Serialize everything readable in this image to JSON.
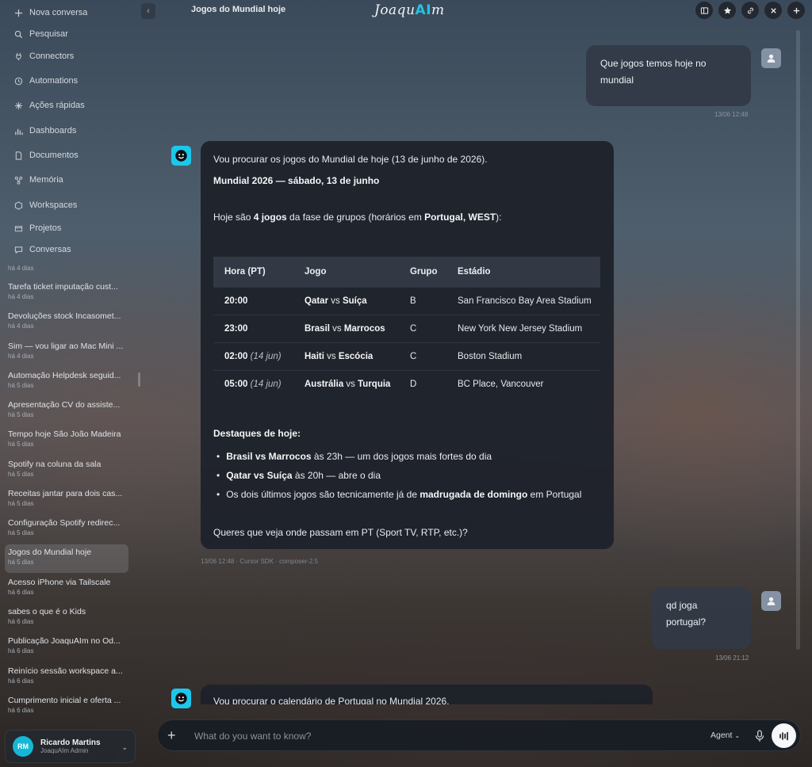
{
  "sidebar": {
    "nav": [
      {
        "label": "Nova conversa",
        "icon": "plus-icon"
      },
      {
        "label": "Pesquisar",
        "icon": "search-icon"
      },
      {
        "label": "Connectors",
        "icon": "plug-icon"
      },
      {
        "label": "Automations",
        "icon": "clock-icon"
      },
      {
        "label": "Ações rápidas",
        "icon": "sparkle-icon"
      },
      {
        "label": "Dashboards",
        "icon": "bar-chart-icon"
      },
      {
        "label": "Documentos",
        "icon": "document-icon"
      },
      {
        "label": "Memória",
        "icon": "memory-icon"
      },
      {
        "label": "Workspaces",
        "icon": "hexagon-icon"
      },
      {
        "label": "Projetos",
        "icon": "folder-icon"
      },
      {
        "label": "Conversas",
        "icon": "chat-bubble-icon"
      }
    ],
    "partial_date": "há 4 dias",
    "conversations": [
      {
        "title": "Tarefa ticket imputação cust...",
        "date": "há 4 dias"
      },
      {
        "title": "Devoluções stock Incasomet...",
        "date": "há 4 dias"
      },
      {
        "title": "Sim — vou ligar ao Mac Mini ...",
        "date": "há 4 dias"
      },
      {
        "title": "Automação Helpdesk seguid...",
        "date": "há 5 dias"
      },
      {
        "title": "Apresentação CV do assiste...",
        "date": "há 5 dias"
      },
      {
        "title": "Tempo hoje São João Madeira",
        "date": "há 5 dias"
      },
      {
        "title": "Spotify na coluna da sala",
        "date": "há 5 dias"
      },
      {
        "title": "Receitas jantar para dois cas...",
        "date": "há 5 dias"
      },
      {
        "title": "Configuração Spotify redirec...",
        "date": "há 5 dias"
      },
      {
        "title": "Jogos do Mundial hoje",
        "date": "há 5 dias"
      },
      {
        "title": "Acesso iPhone via Tailscale",
        "date": "há 6 dias"
      },
      {
        "title": "sabes o que é o Kids",
        "date": "há 6 dias"
      },
      {
        "title": "Publicação JoaquAIm no Od...",
        "date": "há 6 dias"
      },
      {
        "title": "Reinício sessão workspace a...",
        "date": "há 6 dias"
      },
      {
        "title": "Cumprimento inicial e oferta ...",
        "date": "há 6 dias"
      }
    ],
    "active_index": 9,
    "user": {
      "initials": "RM",
      "name": "Ricardo Martins",
      "role": "JoaquAIm Admin",
      "avatar_color": "#14b8d6"
    }
  },
  "header": {
    "title": "Jogos do Mundial hoje",
    "logo_pre": "Joaqu",
    "logo_ai": "AI",
    "logo_post": "m",
    "accent": "#21c4e6"
  },
  "messages": {
    "m1": {
      "line1": "Que jogos temos hoje no",
      "line2": "mundial",
      "time": "13/06 12:48"
    },
    "m2": {
      "intro": "Vou procurar os jogos do Mundial de hoje (13 de junho de 2026).",
      "heading": "Mundial 2026 — sábado, 13 de junho",
      "summary_a": "Hoje são ",
      "summary_b": "4 jogos",
      "summary_c": " da fase de grupos (horários em ",
      "summary_d": "Portugal, WEST",
      "summary_e": "):",
      "table": {
        "headers": [
          "Hora (PT)",
          "Jogo",
          "Grupo",
          "Estádio"
        ],
        "rows": [
          {
            "time": "20:00",
            "note": "",
            "team1": "Qatar",
            "vs": "vs",
            "team2": "Suíça",
            "group": "B",
            "stadium": "San Francisco Bay Area Stadium"
          },
          {
            "time": "23:00",
            "note": "",
            "team1": "Brasil",
            "vs": "vs",
            "team2": "Marrocos",
            "group": "C",
            "stadium": "New York New Jersey Stadium"
          },
          {
            "time": "02:00",
            "note": "(14 jun)",
            "team1": "Haiti",
            "vs": "vs",
            "team2": "Escócia",
            "group": "C",
            "stadium": "Boston Stadium"
          },
          {
            "time": "05:00",
            "note": "(14 jun)",
            "team1": "Austrália",
            "vs": "vs",
            "team2": "Turquia",
            "group": "D",
            "stadium": "BC Place, Vancouver"
          }
        ]
      },
      "highlights_title": "Destaques de hoje:",
      "highlights": [
        {
          "bold": "Brasil vs Marrocos",
          "text": " às 23h — um dos jogos mais fortes do dia",
          "bold2": "",
          "text2": ""
        },
        {
          "bold": "Qatar vs Suíça",
          "text": " às 20h — abre o dia",
          "bold2": "",
          "text2": ""
        },
        {
          "bold": "",
          "text": "Os dois últimos jogos são tecnicamente já de ",
          "bold2": "madrugada de domingo",
          "text2": " em Portugal"
        }
      ],
      "question": "Queres que veja onde passam em PT (Sport TV, RTP, etc.)?",
      "meta": "13/06 12:48 · Cursor SDK · composer-2.5"
    },
    "m3": {
      "line1": "qd joga",
      "line2": "portugal?",
      "time": "13/06 21:12"
    },
    "m4": {
      "text": "Vou procurar o calendário de Portugal no Mundial 2026."
    }
  },
  "composer": {
    "placeholder": "What do you want to know?",
    "mode": "Agent",
    "value": ""
  }
}
